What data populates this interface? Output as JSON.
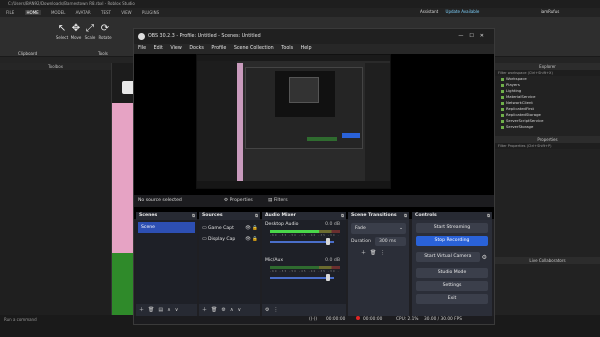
{
  "studio": {
    "title": "C:/Users/BAN92/Downloads/Barnestown R8.rbxl - Roblox Studio",
    "menu": [
      "FILE",
      "HOME",
      "MODEL",
      "AVATAR",
      "TEST",
      "VIEW",
      "PLUGINS"
    ],
    "ribbon_tools": [
      {
        "label": "Select",
        "icon": "cursor-icon"
      },
      {
        "label": "Move",
        "icon": "move-icon"
      },
      {
        "label": "Scale",
        "icon": "scale-icon"
      },
      {
        "label": "Rotate",
        "icon": "rotate-icon"
      }
    ],
    "ribbon_tabs_left": [
      "Clipboard",
      "Tools"
    ],
    "toolbox_title": "Toolbox",
    "explorer_title": "Explorer",
    "explorer_filter": "Filter workspace (Ctrl+Shift+X)",
    "explorer_items": [
      "Workspace",
      "Players",
      "Lighting",
      "MaterialService",
      "NetworkClient",
      "ReplicatedFirst",
      "ReplicatedStorage",
      "ServerScriptService",
      "ServerStorage"
    ],
    "properties_title": "Properties",
    "properties_filter": "Filter Properties (Ctrl+Shift+P)",
    "collaborators_title": "Live Collaborators",
    "assistant_label": "Assistant",
    "update_label": "Update Available",
    "user_label": "iamRufus",
    "command_placeholder": "Run a command"
  },
  "obs": {
    "title": "OBS 30.2.3 - Profile: Untitled - Scenes: Untitled",
    "menu": [
      "File",
      "Edit",
      "View",
      "Docks",
      "Profile",
      "Scene Collection",
      "Tools",
      "Help"
    ],
    "source_status": "No source selected",
    "properties_label": "Properties",
    "filters_label": "Filters",
    "docks": {
      "scenes": {
        "title": "Scenes",
        "items": [
          "Scene"
        ]
      },
      "sources": {
        "title": "Sources",
        "items": [
          {
            "name": "Game Capt",
            "icon": "monitor-icon"
          },
          {
            "name": "Display Cap",
            "icon": "monitor-icon"
          }
        ]
      },
      "mixer": {
        "title": "Audio Mixer",
        "channels": [
          {
            "name": "Desktop Audio",
            "db": "0.0 dB",
            "level": 0.76,
            "volume": 1.0
          },
          {
            "name": "Mic/Aux",
            "db": "0.0 dB",
            "level": 0.0,
            "volume": 1.0
          }
        ],
        "ticks": "-60 -55 -50 -45 -40 -35 -30 -25 -20 -15 -10 -5 0"
      },
      "transitions": {
        "title": "Scene Transitions",
        "type": "Fade",
        "duration_label": "Duration",
        "duration": "300 ms"
      },
      "controls": {
        "title": "Controls",
        "buttons": [
          "Start Streaming",
          "Stop Recording",
          "Start Virtual Camera",
          "Studio Mode",
          "Settings",
          "Exit"
        ]
      }
    },
    "status": {
      "rec_time": "00:00:00",
      "stream_time": "00:00:00",
      "cpu": "CPU: 2.1%",
      "fps": "30.00 / 30.00 FPS"
    }
  },
  "colors": {
    "accent": "#2a62d8",
    "rec": "#e02525",
    "meter": "#49d649"
  }
}
